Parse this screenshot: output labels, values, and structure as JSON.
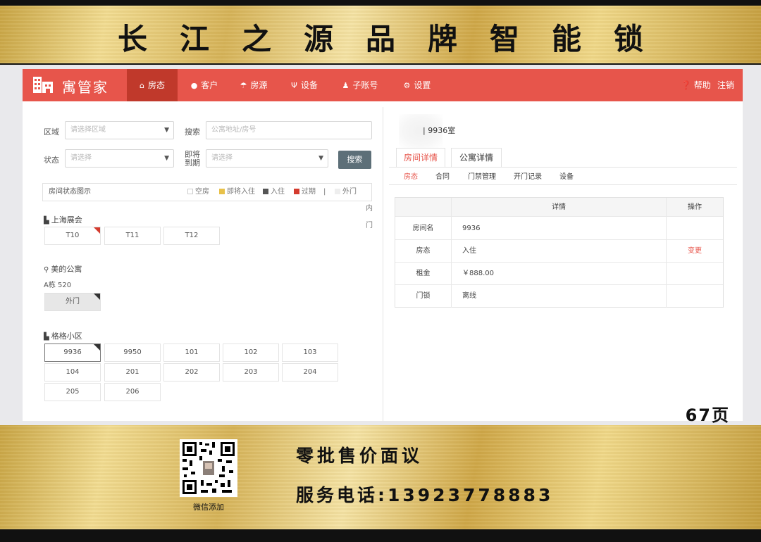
{
  "banner_top": {
    "title": "长江之源品牌智能锁"
  },
  "page_number": "67页",
  "app": {
    "logo_text": "寓管家",
    "nav": {
      "items": [
        {
          "label": "房态",
          "icon": "home-icon",
          "active": true
        },
        {
          "label": "客户",
          "icon": "user-icon",
          "active": false
        },
        {
          "label": "房源",
          "icon": "umbrella-icon",
          "active": false
        },
        {
          "label": "设备",
          "icon": "device-icon",
          "active": false
        },
        {
          "label": "子账号",
          "icon": "subaccount-icon",
          "active": false
        },
        {
          "label": "设置",
          "icon": "gear-icon",
          "active": false
        }
      ],
      "help": "帮助",
      "logout": "注销"
    },
    "filters": {
      "region_label": "区域",
      "region_placeholder": "请选择区域",
      "search_label": "搜索",
      "search_placeholder": "公寓地址/房号",
      "status_label": "状态",
      "status_placeholder": "请选择",
      "expiring_label_1": "即将",
      "expiring_label_2": "到期",
      "expiring_placeholder": "请选择",
      "search_button": "搜索"
    },
    "legend": {
      "title": "房间状态图示",
      "items": [
        {
          "label": "空房",
          "color": "#ffffff"
        },
        {
          "label": "即将入住",
          "color": "#e8c14a"
        },
        {
          "label": "入住",
          "color": "#555555"
        },
        {
          "label": "过期",
          "color": "#d43b2e"
        },
        {
          "label": "|",
          "color": ""
        },
        {
          "label": "外门",
          "color": "#eeeeee"
        },
        {
          "label": "内门",
          "color": "#ffffff"
        }
      ]
    },
    "groups": {
      "g1": {
        "title": "上海展会",
        "rooms": [
          "T10",
          "T11",
          "T12"
        ]
      },
      "g2": {
        "title": "美的公寓",
        "building": "A栋 520",
        "rooms": [
          "外门"
        ]
      },
      "g3": {
        "title": "格格小区",
        "rooms": [
          "9936",
          "9950",
          "101",
          "102",
          "103",
          "104",
          "201",
          "202",
          "203",
          "204",
          "205",
          "206"
        ]
      }
    },
    "detail": {
      "room_title": "| 9936室",
      "tabs": [
        "房间详情",
        "公寓详情"
      ],
      "sub_tabs": [
        "房态",
        "合同",
        "门禁管理",
        "开门记录",
        "设备"
      ],
      "table": {
        "header": {
          "detail": "详情",
          "action": "操作"
        },
        "rows": [
          {
            "key": "房间名",
            "value": "9936",
            "action": ""
          },
          {
            "key": "房态",
            "value": "入住",
            "action": "变更"
          },
          {
            "key": "租金",
            "value": "￥888.00",
            "action": ""
          },
          {
            "key": "门锁",
            "value": "离线",
            "action": ""
          }
        ]
      }
    }
  },
  "banner_bottom": {
    "qr_caption": "微信添加",
    "slogan": "零批售价面议",
    "phone": "服务电话:13923778883"
  }
}
